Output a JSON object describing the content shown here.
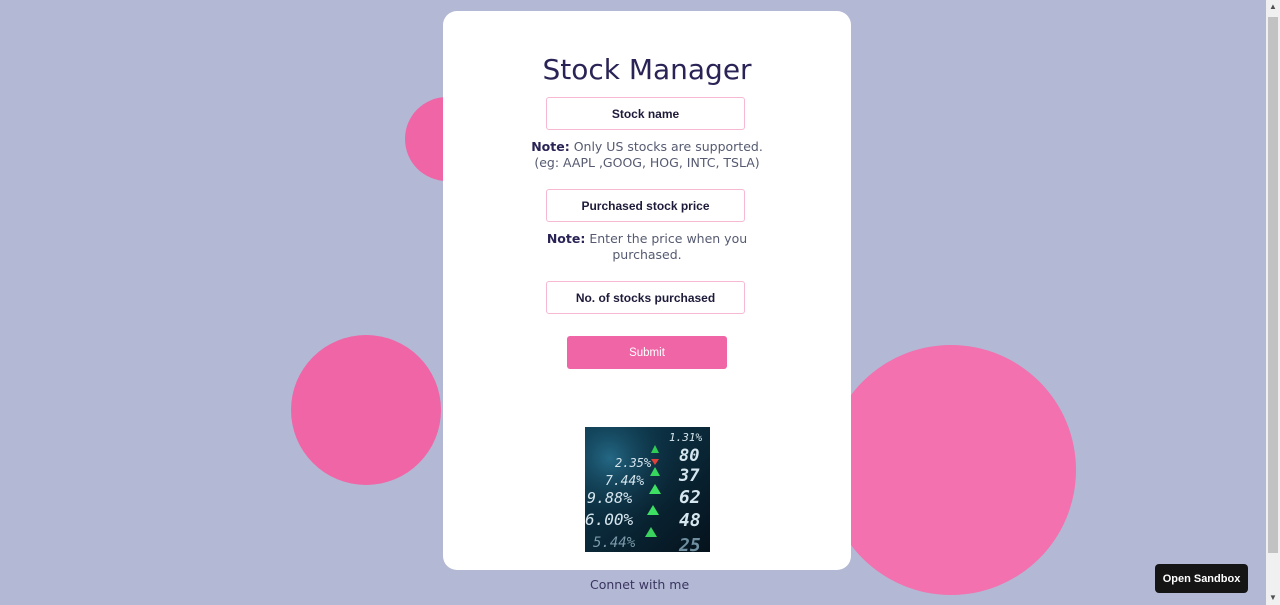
{
  "app": {
    "title": "Stock Manager"
  },
  "form": {
    "stock_name_placeholder": "Stock name",
    "note1_label": "Note:",
    "note1_text": "Only US stocks are supported. (eg: AAPL ,GOOG, HOG, INTC, TSLA)",
    "price_placeholder": "Purchased stock price",
    "note2_label": "Note:",
    "note2_text": "Enter the price when you purchased.",
    "quantity_placeholder": "No. of stocks purchased",
    "submit_label": "Submit"
  },
  "image": {
    "tickers": [
      "1.31%",
      "80",
      "2.35%",
      "37",
      "7.44%",
      "62",
      "9.88%",
      "48",
      "6.00%",
      "25",
      "5.44%"
    ]
  },
  "footer": {
    "connect_label": "Connet with me"
  },
  "overlay": {
    "sandbox_button": "Open Sandbox"
  },
  "icons": {
    "scroll_up": "triangle-up",
    "scroll_down": "triangle-down"
  },
  "colors": {
    "background": "#b3b8d4",
    "accent": "#f065a6",
    "title": "#2a2456",
    "card": "#ffffff"
  }
}
